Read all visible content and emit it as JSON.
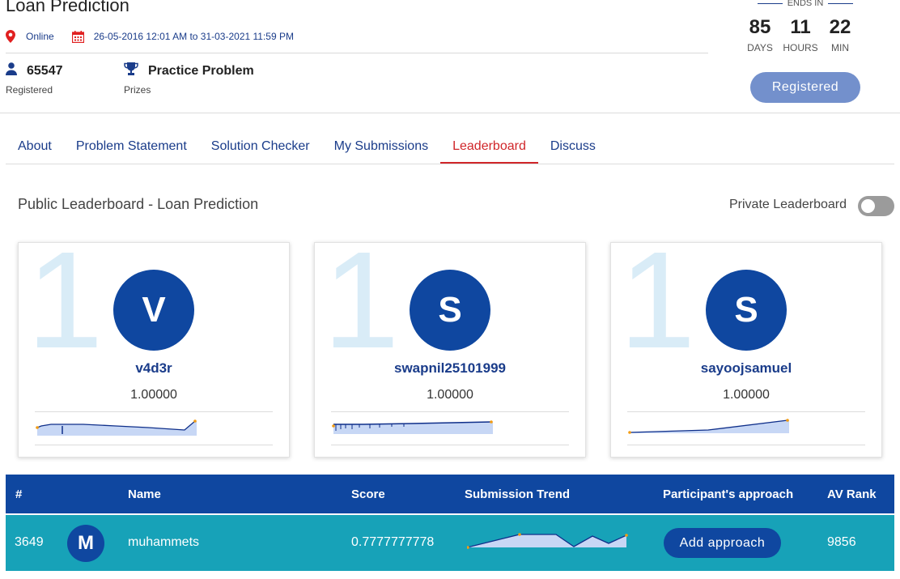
{
  "header": {
    "title": "Loan Prediction",
    "mode": "Online",
    "dates": "26-05-2016 12:01 AM to 31-03-2021 11:59 PM",
    "registered_count": "65547",
    "registered_label": "Registered",
    "prize": "Practice Problem",
    "prize_label": "Prizes",
    "ends_in": "ENDS IN",
    "countdown": [
      {
        "value": "85",
        "unit": "DAYS"
      },
      {
        "value": "11",
        "unit": "HOURS"
      },
      {
        "value": "22",
        "unit": "MIN"
      }
    ],
    "registered_button": "Registered"
  },
  "tabs": [
    {
      "label": "About"
    },
    {
      "label": "Problem Statement"
    },
    {
      "label": "Solution Checker"
    },
    {
      "label": "My Submissions"
    },
    {
      "label": "Leaderboard",
      "active": true
    },
    {
      "label": "Discuss"
    }
  ],
  "leaderboard": {
    "title": "Public Leaderboard - Loan Prediction",
    "private_label": "Private Leaderboard",
    "private_enabled": false
  },
  "top_cards": [
    {
      "rank": "1",
      "initial": "V",
      "username": "v4d3r",
      "score": "1.00000"
    },
    {
      "rank": "1",
      "initial": "S",
      "username": "swapnil25101999",
      "score": "1.00000"
    },
    {
      "rank": "1",
      "initial": "S",
      "username": "sayoojsamuel",
      "score": "1.00000"
    }
  ],
  "table": {
    "headers": {
      "rank": "#",
      "name": "Name",
      "score": "Score",
      "trend": "Submission Trend",
      "approach": "Participant's approach",
      "av_rank": "AV Rank"
    },
    "row": {
      "rank": "3649",
      "initial": "M",
      "name": "muhammets",
      "score": "0.7777777778",
      "approach_button": "Add approach",
      "av_rank": "9856"
    }
  },
  "colors": {
    "brand_blue": "#0f47a0",
    "link_blue": "#1a3c8a",
    "active_tab": "#d0262a",
    "row_teal": "#17a2b8",
    "registered_button": "#7390cc"
  }
}
